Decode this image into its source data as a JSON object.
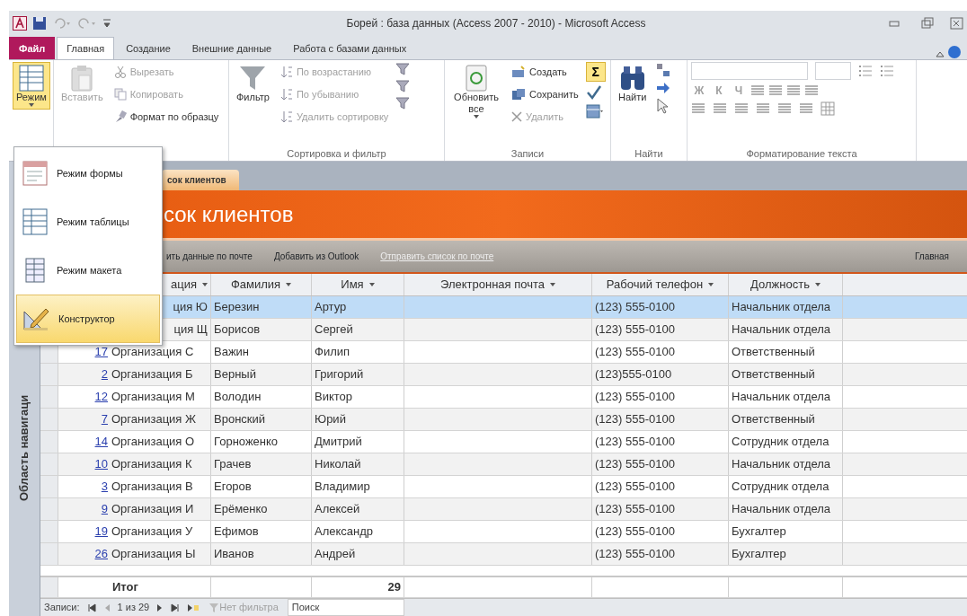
{
  "window": {
    "title": "Борей : база данных (Access 2007 - 2010) - Microsoft Access"
  },
  "ribbon_tabs": [
    {
      "label": "Файл",
      "kind": "file",
      "selected": false
    },
    {
      "label": "Главная",
      "kind": "tab",
      "selected": true
    },
    {
      "label": "Создание",
      "kind": "tab",
      "selected": false
    },
    {
      "label": "Внешние данные",
      "kind": "tab",
      "selected": false
    },
    {
      "label": "Работа с базами данных",
      "kind": "tab",
      "selected": false
    }
  ],
  "ribbon_groups": [
    {
      "kind": "views",
      "items": [
        {
          "label": "Режим",
          "kind": "big",
          "disabled": false,
          "expanded": true
        }
      ]
    },
    {
      "kind": "clipboard",
      "items": [
        {
          "label": "Вставить",
          "kind": "big",
          "disabled": true
        },
        {
          "label": "Вырезать",
          "kind": "small",
          "disabled": true
        },
        {
          "label": "Копировать",
          "kind": "small",
          "disabled": true
        },
        {
          "label": "Формат по образцу",
          "kind": "small",
          "disabled": false
        }
      ]
    },
    {
      "kind": "sort",
      "label": "Сортировка и фильтр",
      "items": [
        {
          "label": "Фильтр",
          "kind": "big",
          "disabled": false
        },
        {
          "label": "По возрастанию",
          "kind": "small",
          "disabled": true
        },
        {
          "label": "По убыванию",
          "kind": "small",
          "disabled": true
        },
        {
          "label": "Удалить сортировку",
          "kind": "small",
          "disabled": true
        }
      ]
    },
    {
      "kind": "records",
      "label": "Записи",
      "items": [
        {
          "label": "Обновить все",
          "kind": "big",
          "disabled": false
        },
        {
          "label": "Создать",
          "kind": "small",
          "disabled": false
        },
        {
          "label": "Сохранить",
          "kind": "small",
          "disabled": false
        },
        {
          "label": "Удалить",
          "kind": "small",
          "disabled": true
        },
        {
          "label": "Σ",
          "kind": "toggle",
          "disabled": false,
          "on": true
        }
      ]
    },
    {
      "kind": "find",
      "label": "Найти",
      "items": [
        {
          "label": "Найти",
          "kind": "big",
          "disabled": false
        }
      ]
    },
    {
      "kind": "text_format",
      "label": "Форматирование текста",
      "items": [
        {
          "label": "Ж",
          "kind": "letter",
          "disabled": true
        },
        {
          "label": "К",
          "kind": "letter",
          "disabled": true
        },
        {
          "label": "Ч",
          "kind": "letter",
          "disabled": true
        }
      ]
    }
  ],
  "view_menu": {
    "items": [
      {
        "label": "Режим формы",
        "selected": false
      },
      {
        "label": "Режим таблицы",
        "selected": false
      },
      {
        "label": "Режим макета",
        "selected": false
      },
      {
        "label": "Конструктор",
        "selected": true
      }
    ]
  },
  "navigation_pane": {
    "label": "Область навигаци"
  },
  "document_tabs": [
    {
      "label": "сок клиентов",
      "selected": true
    }
  ],
  "form": {
    "title": "сок клиентов",
    "actions": [
      "ить данные по почте",
      "Добавить из Outlook",
      "Отправить список по почте"
    ],
    "home_link": "Главная"
  },
  "table": {
    "columns": [
      "ация",
      "Фамилия",
      "Имя",
      "Электронная почта",
      "Рабочий телефон",
      "Должность"
    ],
    "rows": [
      {
        "org": "ция Ю",
        "last": "Березин",
        "first": "Артур",
        "phone": "(123) 555-0100",
        "position": "Начальник отдела",
        "selected": true
      },
      {
        "org": "ция Щ",
        "last": "Борисов",
        "first": "Сергей",
        "phone": "(123) 555-0100",
        "position": "Начальник отдела",
        "selected": false
      },
      {
        "id": "17",
        "org": "Организация С",
        "last": "Важин",
        "first": "Филип",
        "phone": "(123) 555-0100",
        "position": "Ответственный",
        "selected": false
      },
      {
        "id": "2",
        "org": "Организация Б",
        "last": "Верный",
        "first": "Григорий",
        "phone": "(123)555-0100",
        "position": "Ответственный",
        "selected": false
      },
      {
        "id": "12",
        "org": "Организация М",
        "last": "Володин",
        "first": "Виктор",
        "phone": "(123) 555-0100",
        "position": "Начальник отдела",
        "selected": false
      },
      {
        "id": "7",
        "org": "Организация Ж",
        "last": "Вронский",
        "first": "Юрий",
        "phone": "(123) 555-0100",
        "position": "Ответственный",
        "selected": false
      },
      {
        "id": "14",
        "org": "Организация О",
        "last": "Горноженко",
        "first": "Дмитрий",
        "phone": "(123) 555-0100",
        "position": "Сотрудник отдела",
        "selected": false
      },
      {
        "id": "10",
        "org": "Организация К",
        "last": "Грачев",
        "first": "Николай",
        "phone": "(123) 555-0100",
        "position": "Начальник отдела",
        "selected": false
      },
      {
        "id": "3",
        "org": "Организация В",
        "last": "Егоров",
        "first": "Владимир",
        "phone": "(123) 555-0100",
        "position": "Сотрудник отдела",
        "selected": false
      },
      {
        "id": "9",
        "org": "Организация И",
        "last": "Ерёменко",
        "first": "Алексей",
        "phone": "(123) 555-0100",
        "position": "Начальник отдела",
        "selected": false
      },
      {
        "id": "19",
        "org": "Организация У",
        "last": "Ефимов",
        "first": "Александр",
        "phone": "(123) 555-0100",
        "position": "Бухгалтер",
        "selected": false
      },
      {
        "id": "26",
        "org": "Организация Ы",
        "last": "Иванов",
        "first": "Андрей",
        "phone": "(123) 555-0100",
        "position": "Бухгалтер",
        "selected": false
      }
    ],
    "totals": {
      "label": "Итог",
      "count": "29"
    }
  },
  "status_bar": {
    "label": "Записи:",
    "position": "1 из 29",
    "filter": "Нет фильтра",
    "search": "Поиск"
  }
}
